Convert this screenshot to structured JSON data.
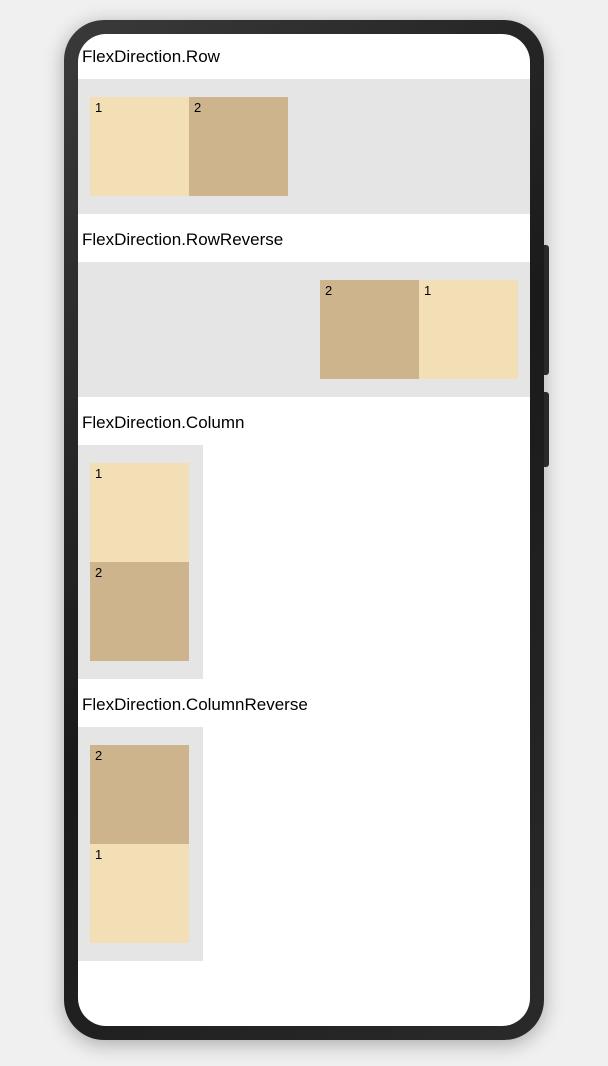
{
  "sections": {
    "row": {
      "title": "FlexDirection.Row",
      "box1_label": "1",
      "box2_label": "2"
    },
    "rowReverse": {
      "title": "FlexDirection.RowReverse",
      "box1_label": "1",
      "box2_label": "2"
    },
    "column": {
      "title": "FlexDirection.Column",
      "box1_label": "1",
      "box2_label": "2"
    },
    "columnReverse": {
      "title": "FlexDirection.ColumnReverse",
      "box1_label": "1",
      "box2_label": "2"
    }
  },
  "colors": {
    "boxLight": "#f2dfb6",
    "boxDark": "#cdb48c",
    "containerBg": "#e5e5e5",
    "screenBg": "#ffffff",
    "frameDark": "#1a1a1a"
  }
}
